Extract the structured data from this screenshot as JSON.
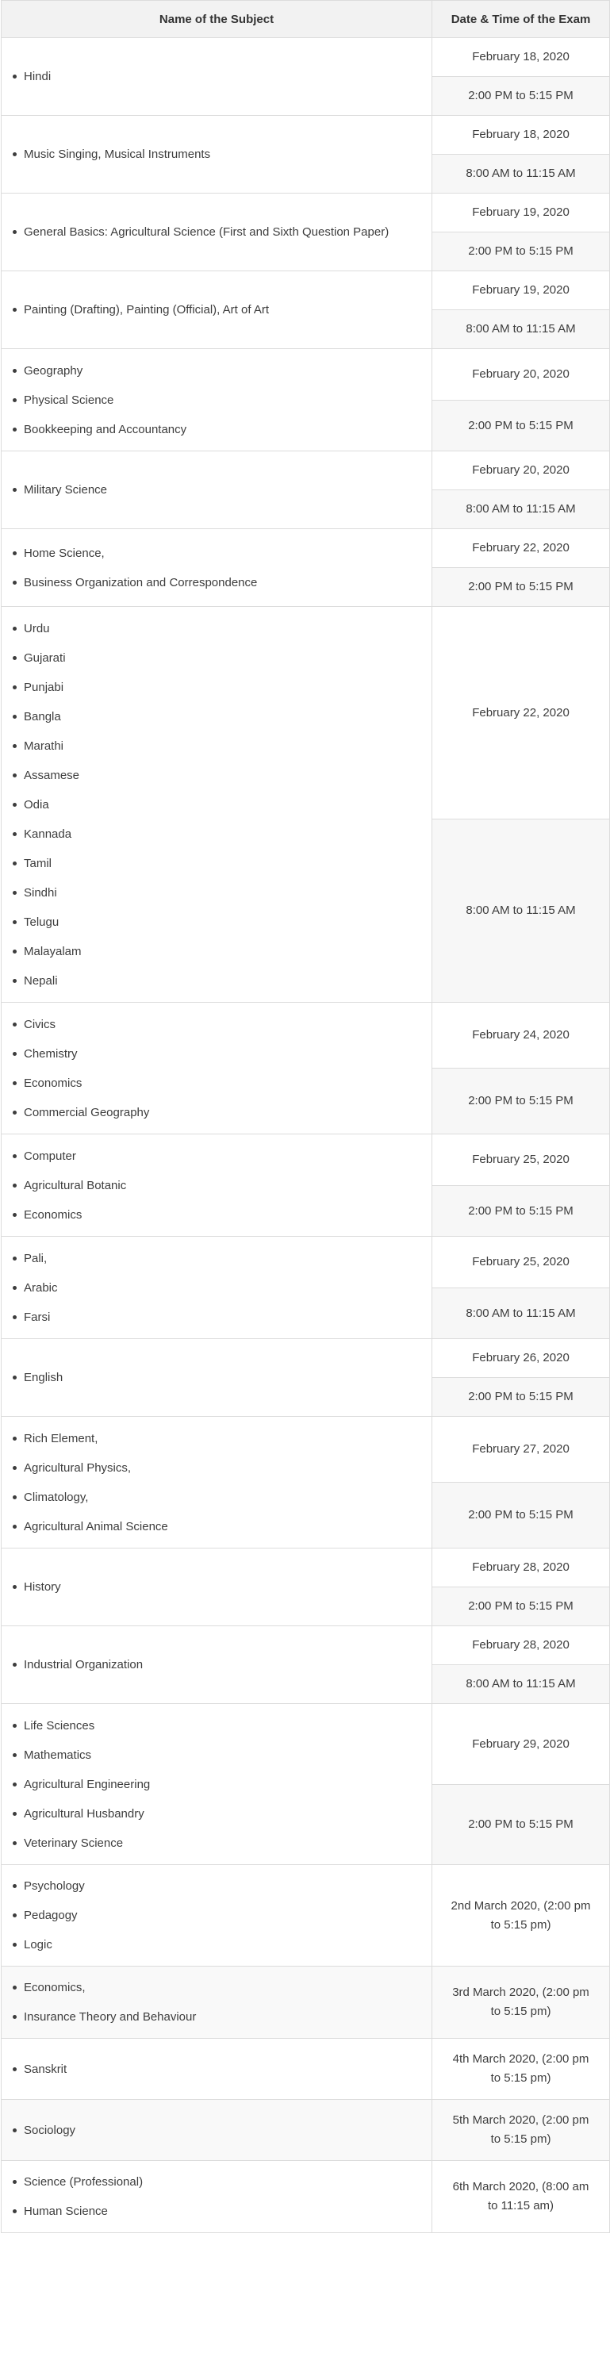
{
  "header": {
    "col1": "Name of the Subject",
    "col2": "Date & Time of the Exam"
  },
  "rows": [
    {
      "subjects": [
        "Hindi"
      ],
      "date": "February 18, 2020",
      "time": "2:00 PM to 5:15 PM"
    },
    {
      "subjects": [
        "Music Singing, Musical Instruments"
      ],
      "date": "February 18, 2020",
      "time": "8:00 AM to 11:15 AM"
    },
    {
      "subjects": [
        "General Basics: Agricultural Science (First and Sixth Question Paper)"
      ],
      "date": "February 19, 2020",
      "time": "2:00 PM to 5:15 PM"
    },
    {
      "subjects": [
        "Painting (Drafting), Painting (Official), Art of Art"
      ],
      "date": "February 19, 2020",
      "time": "8:00 AM to 11:15 AM"
    },
    {
      "subjects": [
        "Geography",
        "Physical Science",
        "Bookkeeping and Accountancy"
      ],
      "date": "February 20, 2020",
      "time": "2:00 PM to 5:15 PM"
    },
    {
      "subjects": [
        "Military Science"
      ],
      "date": "February 20, 2020",
      "time": "8:00 AM to 11:15 AM"
    },
    {
      "subjects": [
        "Home Science,",
        "Business Organization and Correspondence"
      ],
      "date": "February 22, 2020",
      "time": "2:00 PM to 5:15 PM"
    },
    {
      "subjects": [
        "Urdu",
        "Gujarati",
        "Punjabi",
        "Bangla",
        "Marathi",
        "Assamese",
        "Odia",
        "Kannada",
        "Tamil",
        "Sindhi",
        "Telugu",
        "Malayalam",
        "Nepali"
      ],
      "date": "February 22, 2020",
      "time": "8:00 AM to 11:15 AM",
      "split": 7
    },
    {
      "subjects": [
        "Civics",
        "Chemistry",
        "Economics",
        "Commercial Geography"
      ],
      "date": "February 24, 2020",
      "time": "2:00 PM to 5:15 PM"
    },
    {
      "subjects": [
        "Computer",
        "Agricultural Botanic",
        "Economics"
      ],
      "date": "February 25, 2020",
      "time": "2:00 PM to 5:15 PM"
    },
    {
      "subjects": [
        "Pali,",
        "Arabic",
        "Farsi"
      ],
      "date": "February 25, 2020",
      "time": "8:00 AM to 11:15 AM"
    },
    {
      "subjects": [
        "English"
      ],
      "date": "February 26, 2020",
      "time": "2:00 PM to 5:15 PM"
    },
    {
      "subjects": [
        "Rich Element,",
        "Agricultural Physics,",
        "Climatology,",
        "Agricultural Animal Science"
      ],
      "date": "February 27, 2020",
      "time": "2:00 PM to 5:15 PM"
    },
    {
      "subjects": [
        "History"
      ],
      "date": "February 28, 2020",
      "time": "2:00 PM to 5:15 PM"
    },
    {
      "subjects": [
        "Industrial Organization"
      ],
      "date": "February 28, 2020",
      "time": "8:00 AM to 11:15 AM"
    },
    {
      "subjects": [
        "Life Sciences",
        "Mathematics",
        "Agricultural Engineering",
        "Agricultural Husbandry",
        "Veterinary Science"
      ],
      "date": "February 29, 2020",
      "time": "2:00 PM to 5:15 PM"
    },
    {
      "subjects": [
        "Psychology",
        "Pedagogy",
        "Logic"
      ],
      "combined": "2nd March 2020, (2:00 pm to 5:15 pm)"
    },
    {
      "subjects": [
        "Economics,",
        "Insurance Theory and Behaviour"
      ],
      "combined": "3rd March 2020, (2:00 pm to 5:15 pm)",
      "shade": true
    },
    {
      "subjects": [
        "Sanskrit"
      ],
      "combined": "4th March 2020, (2:00 pm to 5:15 pm)"
    },
    {
      "subjects": [
        "Sociology"
      ],
      "combined": "5th March 2020, (2:00 pm to 5:15 pm)",
      "shade": true
    },
    {
      "subjects": [
        "Science (Professional)",
        "Human Science"
      ],
      "combined": "6th March 2020, (8:00 am to 11:15 am)"
    }
  ]
}
